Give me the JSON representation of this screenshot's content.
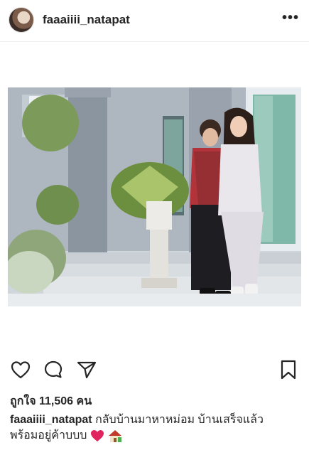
{
  "post": {
    "username": "faaaiiii_natapat",
    "likes_text": "ถูกใจ 11,506 คน",
    "caption_line1": "กลับบ้านมาหาหม่อม บ้านเสร็จแล้ว",
    "caption_line2": "พร้อมอยู่ค้าบบบ",
    "caption_emojis": [
      "heart-emoji",
      "house-emoji"
    ]
  },
  "icons": {
    "more": "more-options-icon",
    "like": "heart-icon",
    "comment": "comment-icon",
    "share": "share-icon",
    "save": "bookmark-icon"
  },
  "colors": {
    "text": "#262626",
    "divider": "#efefef",
    "heart_emoji": "#e0245e"
  }
}
